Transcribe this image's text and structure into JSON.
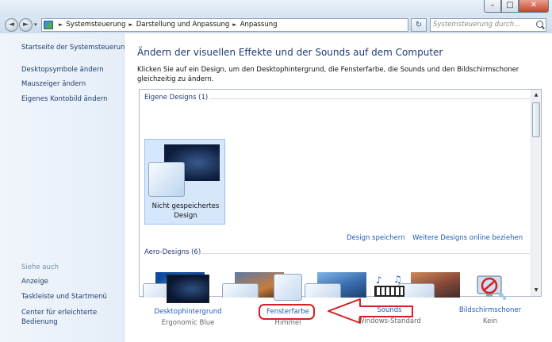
{
  "window": {
    "minimize_glyph": "–",
    "maximize_glyph": "□",
    "close_glyph": "✕"
  },
  "nav": {
    "back_glyph": "◄",
    "forward_glyph": "►",
    "history_glyph": "▾"
  },
  "address": {
    "crumbs": [
      "Systemsteuerung",
      "Darstellung und Anpassung",
      "Anpassung"
    ],
    "sep_glyph": "►",
    "dropdown_glyph": "▾",
    "refresh_glyph": "↻"
  },
  "search": {
    "placeholder": "Systemsteuerung durch..."
  },
  "sidebar": {
    "home": "Startseite der Systemsteuerung",
    "items": [
      "Desktopsymbole ändern",
      "Mauszeiger ändern",
      "Eigenes Kontobild ändern"
    ],
    "see_also_title": "Siehe auch",
    "see_also": [
      "Anzeige",
      "Taskleiste und Startmenü",
      "Center für erleichterte Bedienung"
    ]
  },
  "main": {
    "title": "Ändern der visuellen Effekte und der Sounds auf dem Computer",
    "description": "Klicken Sie auf ein Design, um den Desktophintergrund, die Fensterfarbe, die Sounds und den Bildschirmschoner gleichzeitig zu ändern."
  },
  "gallery": {
    "group_own": "Eigene Designs (1)",
    "unsaved_theme": "Nicht gespeichertes Design",
    "save_link": "Design speichern",
    "online_link": "Weitere Designs online beziehen",
    "group_aero": "Aero-Designs (6)",
    "scroll_up_glyph": "▲",
    "scroll_down_glyph": "▼"
  },
  "bottom": [
    {
      "label": "Desktophintergrund",
      "value": "Ergonomic Blue"
    },
    {
      "label": "Fensterfarbe",
      "value": "Himmel"
    },
    {
      "label": "Sounds",
      "value": "Windows-Standard"
    },
    {
      "label": "Bildschirmschoner",
      "value": "Kein"
    }
  ],
  "colors": {
    "link": "#1e5cb5",
    "title": "#1f3b76",
    "annotation_red": "#d42020"
  }
}
